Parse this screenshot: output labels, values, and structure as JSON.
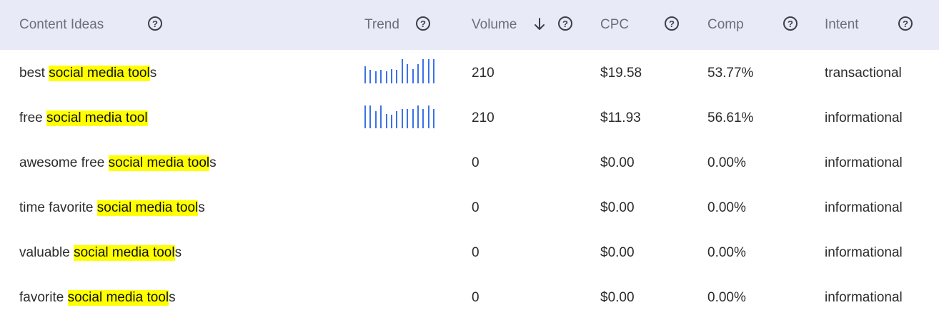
{
  "columns": {
    "content_ideas": "Content Ideas",
    "trend": "Trend",
    "volume": "Volume",
    "cpc": "CPC",
    "comp": "Comp",
    "intent": "Intent",
    "help_glyph": "?"
  },
  "colors": {
    "header_bg": "#e8ebf7",
    "highlight": "#ffff00",
    "trend_bar": "#3c72e6"
  },
  "rows": [
    {
      "prefix": "best ",
      "highlight": "social media tool",
      "suffix": "s",
      "volume": "210",
      "cpc": "$19.58",
      "comp": "53.77%",
      "intent": "transactional",
      "trend": [
        0.72,
        0.55,
        0.5,
        0.55,
        0.5,
        0.6,
        0.55,
        1.0,
        0.8,
        0.6,
        0.8,
        1.0,
        1.0,
        1.0
      ]
    },
    {
      "prefix": "free ",
      "highlight": "social media tool",
      "suffix": "",
      "volume": "210",
      "cpc": "$11.93",
      "comp": "56.61%",
      "intent": "informational",
      "trend": [
        0.95,
        0.95,
        0.72,
        0.95,
        0.6,
        0.55,
        0.7,
        0.8,
        0.8,
        0.8,
        0.95,
        0.8,
        0.95,
        0.8
      ]
    },
    {
      "prefix": "awesome free ",
      "highlight": "social media tool",
      "suffix": "s",
      "volume": "0",
      "cpc": "$0.00",
      "comp": "0.00%",
      "intent": "informational",
      "trend": []
    },
    {
      "prefix": "time favorite ",
      "highlight": "social media tool",
      "suffix": "s",
      "volume": "0",
      "cpc": "$0.00",
      "comp": "0.00%",
      "intent": "informational",
      "trend": []
    },
    {
      "prefix": "valuable ",
      "highlight": "social media tool",
      "suffix": "s",
      "volume": "0",
      "cpc": "$0.00",
      "comp": "0.00%",
      "intent": "informational",
      "trend": []
    },
    {
      "prefix": "favorite ",
      "highlight": "social media tool",
      "suffix": "s",
      "volume": "0",
      "cpc": "$0.00",
      "comp": "0.00%",
      "intent": "informational",
      "trend": []
    }
  ]
}
